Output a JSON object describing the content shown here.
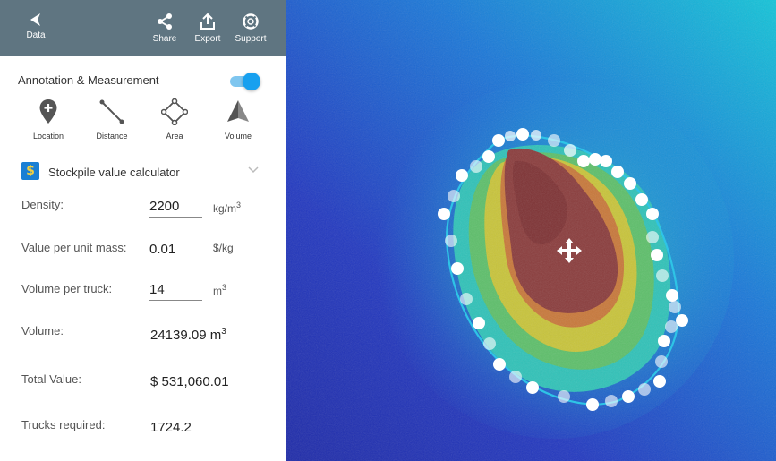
{
  "toolbar": {
    "data_label": "Data",
    "share_label": "Share",
    "export_label": "Export",
    "support_label": "Support"
  },
  "annotation": {
    "title": "Annotation & Measurement",
    "enabled": true,
    "tools": [
      {
        "label": "Location",
        "icon": "location-pin-icon"
      },
      {
        "label": "Distance",
        "icon": "ruler-line-icon"
      },
      {
        "label": "Area",
        "icon": "polygon-area-icon"
      },
      {
        "label": "Volume",
        "icon": "pyramid-volume-icon"
      }
    ]
  },
  "calculator": {
    "title": "Stockpile value calculator",
    "icon_glyph": "$",
    "density_label": "Density:",
    "density_value": "2200",
    "density_unit": "kg/m",
    "density_unit_sup": "3",
    "value_label": "Value per unit mass:",
    "value_value": "0.01",
    "value_unit": "$/kg",
    "truck_label": "Volume per truck:",
    "truck_value": "14",
    "truck_unit": "m",
    "truck_unit_sup": "3",
    "volume_label": "Volume:",
    "volume_value": "24139.09 m",
    "volume_value_sup": "3",
    "total_label": "Total Value:",
    "total_value": "$ 531,060.01",
    "trucks_label": "Trucks required:",
    "trucks_value": "1724.2"
  },
  "colors": {
    "toolbar_bg": "#5f7581",
    "accent": "#17a0ef",
    "polygon_line": "#2ec4e6"
  }
}
